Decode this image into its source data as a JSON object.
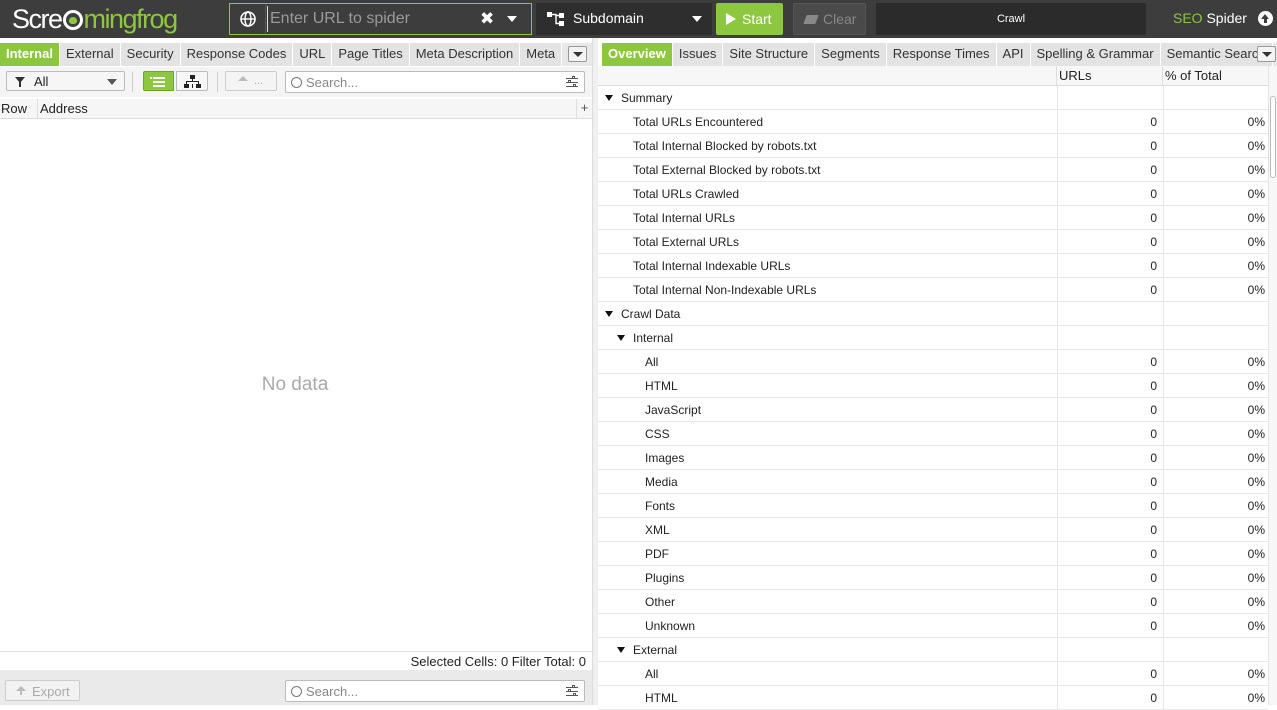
{
  "logo": {
    "part1": "Scre",
    "part2": "ming",
    "part3": "frog"
  },
  "topbar": {
    "url_placeholder": "Enter URL to spider",
    "mode": "Subdomain",
    "start_label": "Start",
    "clear_label": "Clear",
    "crawl_status": "Crawl",
    "product_seo": "SEO",
    "product_spider": " Spider"
  },
  "left": {
    "tabs": [
      "Internal",
      "External",
      "Security",
      "Response Codes",
      "URL",
      "Page Titles",
      "Meta Description",
      "Meta"
    ],
    "active_tab": "Internal",
    "filter": "All",
    "export_small": "...",
    "search_placeholder": "Search...",
    "columns": {
      "row": "Row",
      "address": "Address"
    },
    "empty_text": "No data",
    "status": {
      "selected_label": "Selected Cells:",
      "selected_value": "0",
      "filter_label": "Filter Total:",
      "filter_value": "0"
    },
    "export_label": "Export",
    "bottom_search_placeholder": "Search..."
  },
  "right": {
    "tabs": [
      "Overview",
      "Issues",
      "Site Structure",
      "Segments",
      "Response Times",
      "API",
      "Spelling & Grammar",
      "Semantic Search"
    ],
    "active_tab": "Overview",
    "columns": {
      "urls": "URLs",
      "pct": "% of Total"
    },
    "rows": [
      {
        "label": "Summary",
        "level": 0,
        "group": true
      },
      {
        "label": "Total URLs Encountered",
        "level": 1,
        "urls": "0",
        "pct": "0%"
      },
      {
        "label": "Total Internal Blocked by robots.txt",
        "level": 1,
        "urls": "0",
        "pct": "0%"
      },
      {
        "label": "Total External Blocked by robots.txt",
        "level": 1,
        "urls": "0",
        "pct": "0%"
      },
      {
        "label": "Total URLs Crawled",
        "level": 1,
        "urls": "0",
        "pct": "0%"
      },
      {
        "label": "Total Internal URLs",
        "level": 1,
        "urls": "0",
        "pct": "0%"
      },
      {
        "label": "Total External URLs",
        "level": 1,
        "urls": "0",
        "pct": "0%"
      },
      {
        "label": "Total Internal Indexable URLs",
        "level": 1,
        "urls": "0",
        "pct": "0%"
      },
      {
        "label": "Total Internal Non-Indexable URLs",
        "level": 1,
        "urls": "0",
        "pct": "0%"
      },
      {
        "label": "Crawl Data",
        "level": 0,
        "group": true
      },
      {
        "label": "Internal",
        "level": 1,
        "group": true
      },
      {
        "label": "All",
        "level": 2,
        "urls": "0",
        "pct": "0%"
      },
      {
        "label": "HTML",
        "level": 2,
        "urls": "0",
        "pct": "0%"
      },
      {
        "label": "JavaScript",
        "level": 2,
        "urls": "0",
        "pct": "0%"
      },
      {
        "label": "CSS",
        "level": 2,
        "urls": "0",
        "pct": "0%"
      },
      {
        "label": "Images",
        "level": 2,
        "urls": "0",
        "pct": "0%"
      },
      {
        "label": "Media",
        "level": 2,
        "urls": "0",
        "pct": "0%"
      },
      {
        "label": "Fonts",
        "level": 2,
        "urls": "0",
        "pct": "0%"
      },
      {
        "label": "XML",
        "level": 2,
        "urls": "0",
        "pct": "0%"
      },
      {
        "label": "PDF",
        "level": 2,
        "urls": "0",
        "pct": "0%"
      },
      {
        "label": "Plugins",
        "level": 2,
        "urls": "0",
        "pct": "0%"
      },
      {
        "label": "Other",
        "level": 2,
        "urls": "0",
        "pct": "0%"
      },
      {
        "label": "Unknown",
        "level": 2,
        "urls": "0",
        "pct": "0%"
      },
      {
        "label": "External",
        "level": 1,
        "group": true
      },
      {
        "label": "All",
        "level": 2,
        "urls": "0",
        "pct": "0%"
      },
      {
        "label": "HTML",
        "level": 2,
        "urls": "0",
        "pct": "0%"
      }
    ]
  },
  "colors": {
    "accent": "#8cc73f",
    "topbar": "#3d3d3d"
  }
}
